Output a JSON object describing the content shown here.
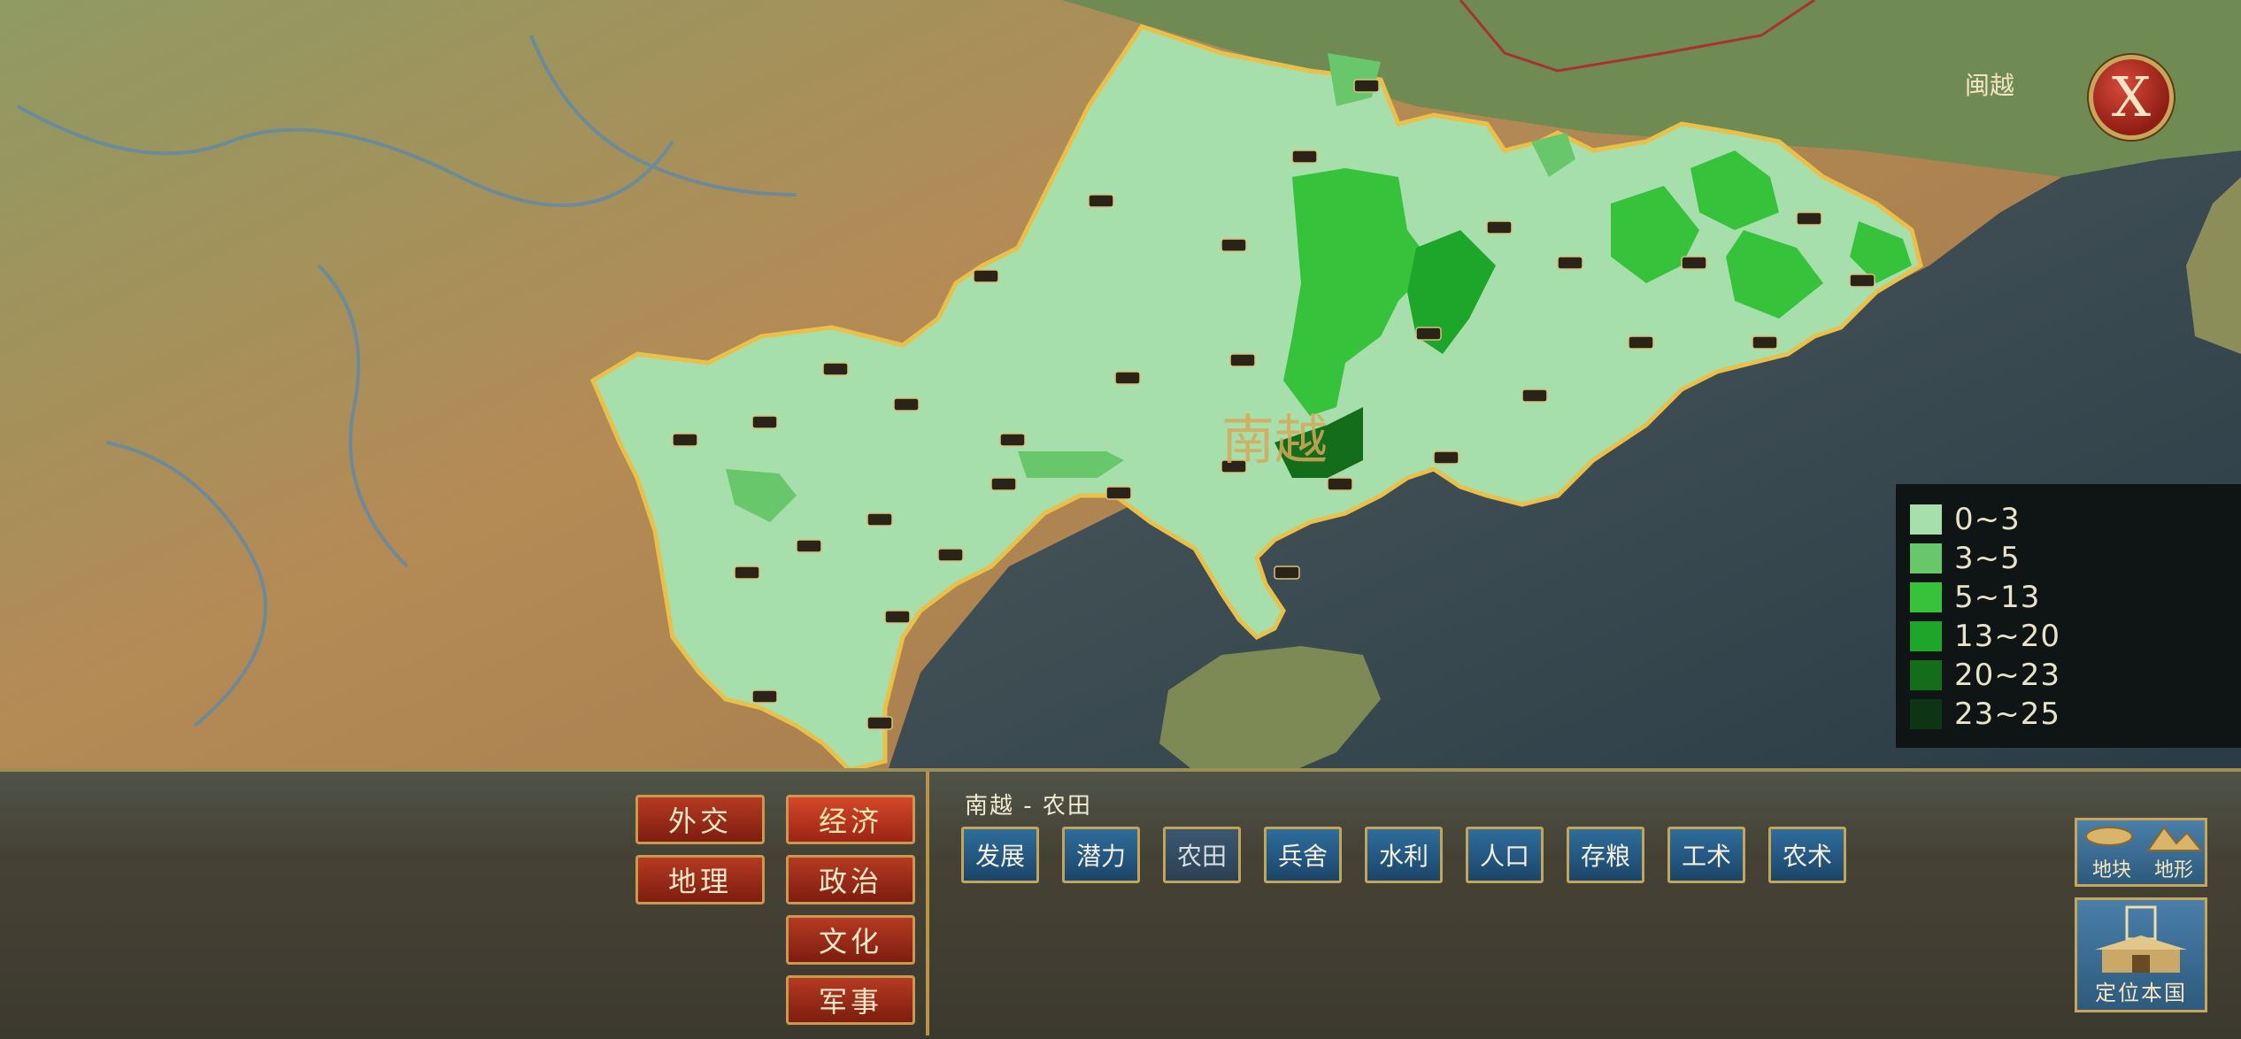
{
  "map": {
    "region_label": "南越",
    "neighbor_label": "闽越"
  },
  "legend": {
    "items": [
      {
        "label": "0~3",
        "color": "#a6dfab"
      },
      {
        "label": "3~5",
        "color": "#67c76a"
      },
      {
        "label": "5~13",
        "color": "#37c23b"
      },
      {
        "label": "13~20",
        "color": "#1ea62a"
      },
      {
        "label": "20~23",
        "color": "#136d1b"
      },
      {
        "label": "23~25",
        "color": "#0d3414"
      }
    ]
  },
  "close_button": {
    "glyph": "X"
  },
  "categories": [
    {
      "label": "外交",
      "active": false
    },
    {
      "label": "经济",
      "active": true
    },
    {
      "label": "地理",
      "active": false
    },
    {
      "label": "政治",
      "active": false
    },
    {
      "label": "文化",
      "active": false
    },
    {
      "label": "军事",
      "active": false
    }
  ],
  "subpanel": {
    "title": "南越 - 农田",
    "buttons": [
      {
        "label": "发展",
        "active": false
      },
      {
        "label": "潜力",
        "active": false
      },
      {
        "label": "农田",
        "active": true
      },
      {
        "label": "兵舍",
        "active": false
      },
      {
        "label": "水利",
        "active": false
      },
      {
        "label": "人口",
        "active": false
      },
      {
        "label": "存粮",
        "active": false
      },
      {
        "label": "工术",
        "active": false
      },
      {
        "label": "农术",
        "active": false
      }
    ]
  },
  "map_mode_button": {
    "label_a": "地块",
    "label_b": "地形"
  },
  "locate_button": {
    "label": "定位本国"
  }
}
